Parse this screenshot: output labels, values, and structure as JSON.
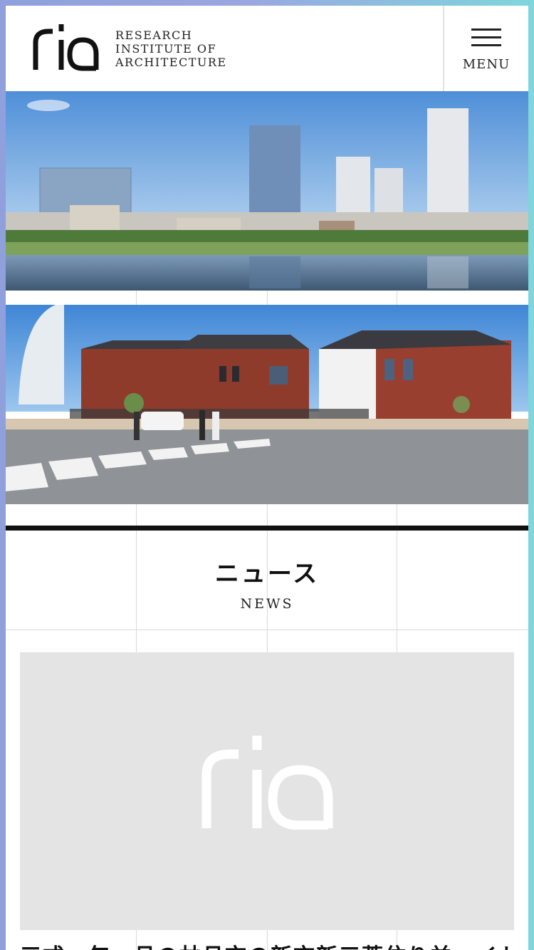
{
  "header": {
    "logo_text": "ria",
    "tagline": [
      "RESEARCH",
      "INSTITUTE OF",
      "ARCHITECTURE"
    ],
    "menu_label": "MENU"
  },
  "hero": [
    {
      "alt": "riverside-towers-photo"
    },
    {
      "alt": "red-brick-warehouse-photo"
    }
  ],
  "news_section": {
    "title_ja": "ニュース",
    "title_en": "NEWS"
  },
  "news_items": [
    {
      "thumbnail_logo": "ria",
      "headline": "三式　年　月の林月市の新市新三菱住り並ーイト"
    }
  ],
  "colors": {
    "gradient_left": "#8fa0dc",
    "gradient_right": "#7fd6dc",
    "text": "#222222",
    "card_bg": "#e4e4e4",
    "rule": "#111111"
  }
}
